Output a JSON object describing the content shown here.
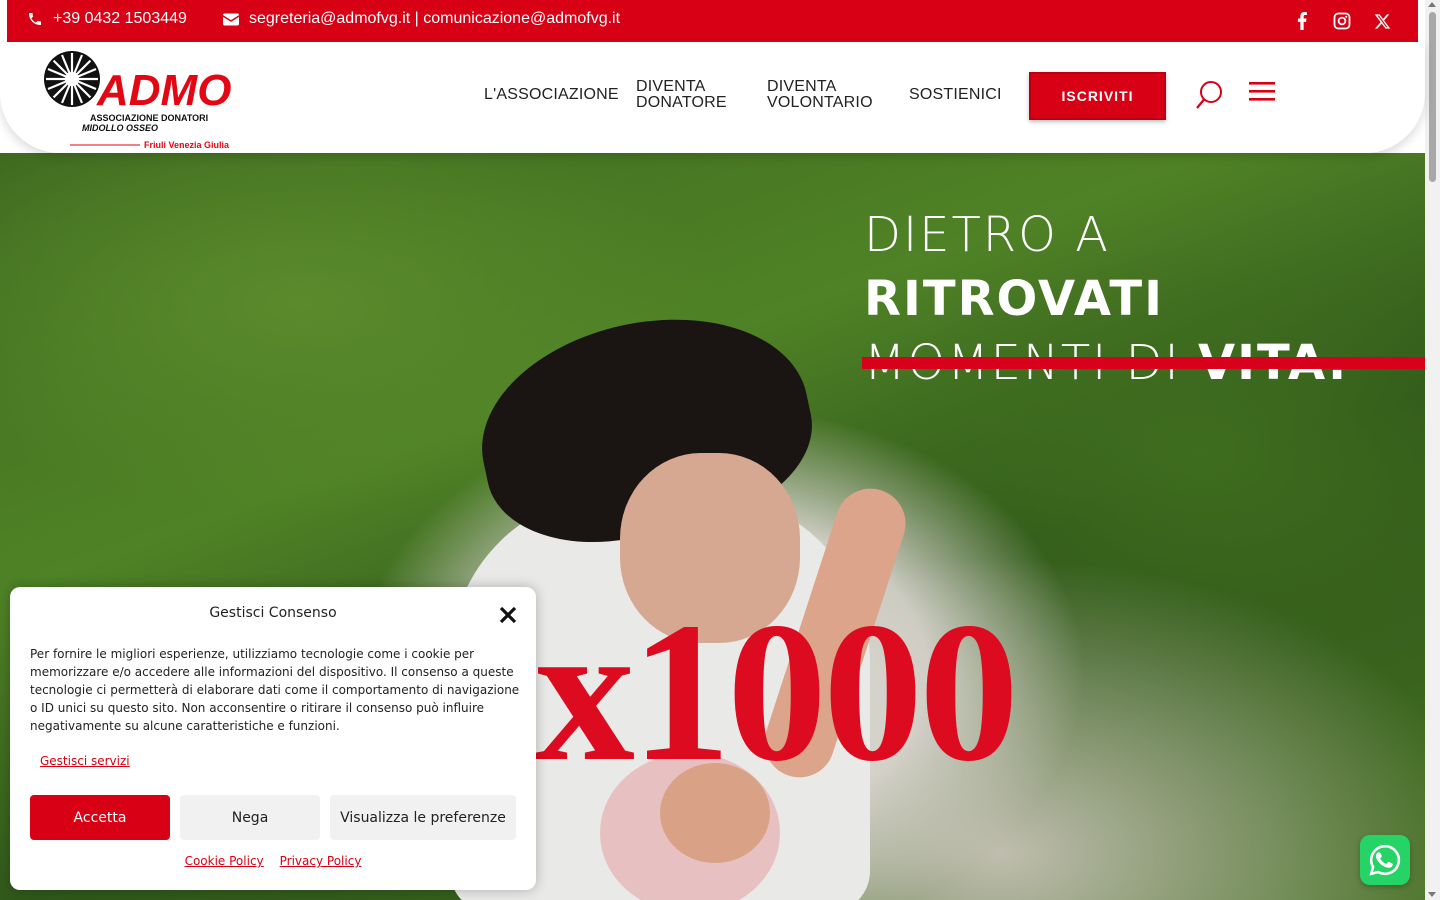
{
  "topbar": {
    "phone": "+39 0432 1503449",
    "email": "segreteria@admofvg.it | comunicazione@admofvg.it",
    "social": [
      "facebook-icon",
      "instagram-icon",
      "x-icon"
    ],
    "color": "#d70015"
  },
  "logo": {
    "brand": "ADMO",
    "line1": "ASSOCIAZIONE DONATORI",
    "line2": "MIDOLLO OSSEO",
    "region": "Friuli Venezia Giulia"
  },
  "nav": {
    "items": [
      {
        "label1": "L'ASSOCIAZIONE",
        "label2": ""
      },
      {
        "label1": "DIVENTA",
        "label2": "DONATORE"
      },
      {
        "label1": "DIVENTA",
        "label2": "VOLONTARIO"
      },
      {
        "label1": "SOSTIENICI",
        "label2": ""
      }
    ],
    "cta": "ISCRIVITI"
  },
  "hero": {
    "line1_light": "DIETRO A ",
    "line1_bold": "RITROVATI",
    "line2_light": "MOMENTI DI ",
    "line2_bold": "VITA.",
    "overlay": "x1000"
  },
  "cookie": {
    "title": "Gestisci Consenso",
    "text": "Per fornire le migliori esperienze, utilizziamo tecnologie come i cookie per memorizzare e/o accedere alle informazioni del dispositivo. Il consenso a queste tecnologie ci permetterà di elaborare dati come il comportamento di navigazione o ID unici su questo sito. Non acconsentire o ritirare il consenso può influire negativamente su alcune caratteristiche e funzioni.",
    "manage_label": "Gestisci servizi",
    "accept_label": "Accetta",
    "deny_label": "Nega",
    "prefs_label": "Visualizza le preferenze",
    "cookie_policy": "Cookie Policy",
    "privacy_policy": "Privacy Policy"
  },
  "accent": "#d70015"
}
